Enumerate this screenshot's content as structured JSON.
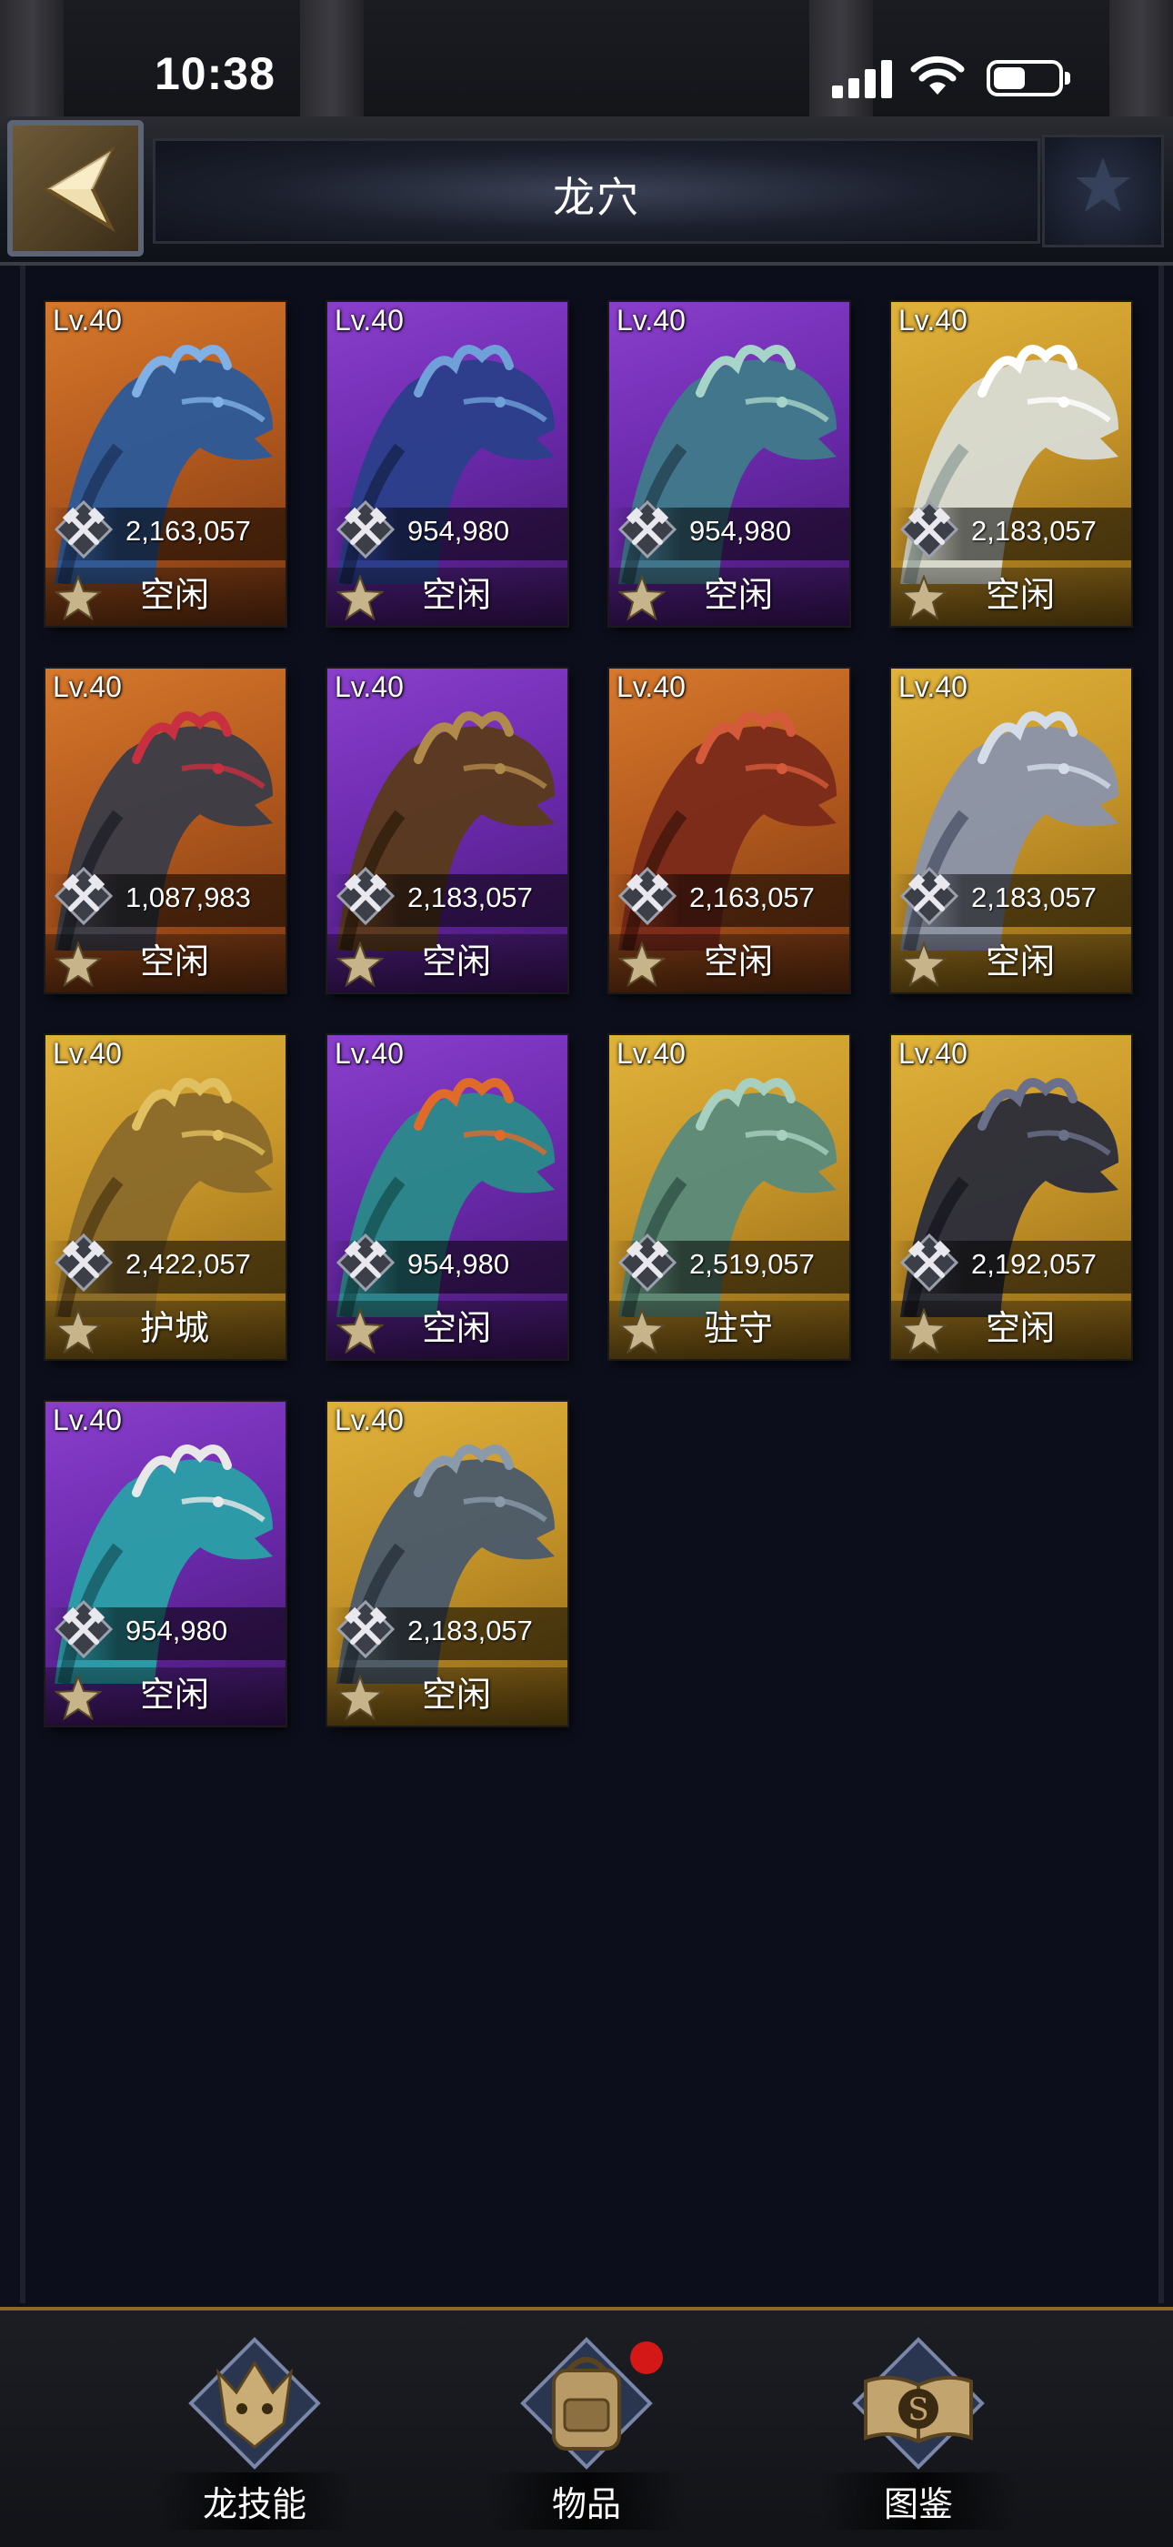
{
  "status_bar": {
    "time": "10:38"
  },
  "header": {
    "title": "龙穴"
  },
  "dragons": [
    {
      "level": "Lv.40",
      "power": "2,163,057",
      "status": "空闲",
      "rarity": "orange"
    },
    {
      "level": "Lv.40",
      "power": "954,980",
      "status": "空闲",
      "rarity": "purple"
    },
    {
      "level": "Lv.40",
      "power": "954,980",
      "status": "空闲",
      "rarity": "purple"
    },
    {
      "level": "Lv.40",
      "power": "2,183,057",
      "status": "空闲",
      "rarity": "gold"
    },
    {
      "level": "Lv.40",
      "power": "1,087,983",
      "status": "空闲",
      "rarity": "orange"
    },
    {
      "level": "Lv.40",
      "power": "2,183,057",
      "status": "空闲",
      "rarity": "purple"
    },
    {
      "level": "Lv.40",
      "power": "2,163,057",
      "status": "空闲",
      "rarity": "orange"
    },
    {
      "level": "Lv.40",
      "power": "2,183,057",
      "status": "空闲",
      "rarity": "gold"
    },
    {
      "level": "Lv.40",
      "power": "2,422,057",
      "status": "护城",
      "rarity": "gold"
    },
    {
      "level": "Lv.40",
      "power": "954,980",
      "status": "空闲",
      "rarity": "purple"
    },
    {
      "level": "Lv.40",
      "power": "2,519,057",
      "status": "驻守",
      "rarity": "gold"
    },
    {
      "level": "Lv.40",
      "power": "2,192,057",
      "status": "空闲",
      "rarity": "gold"
    },
    {
      "level": "Lv.40",
      "power": "954,980",
      "status": "空闲",
      "rarity": "purple"
    },
    {
      "level": "Lv.40",
      "power": "2,183,057",
      "status": "空闲",
      "rarity": "gold"
    }
  ],
  "bottom_nav": [
    {
      "label": "龙技能",
      "icon": "dragon-skill-icon"
    },
    {
      "label": "物品",
      "icon": "backpack-icon",
      "badge": true
    },
    {
      "label": "图鉴",
      "icon": "codex-book-icon"
    }
  ],
  "colors": {
    "orange_card": "#c66a24",
    "purple_card": "#7a33bd",
    "gold_card": "#d2a232",
    "notification": "#d41818",
    "accent_border": "#8c6a2a"
  }
}
